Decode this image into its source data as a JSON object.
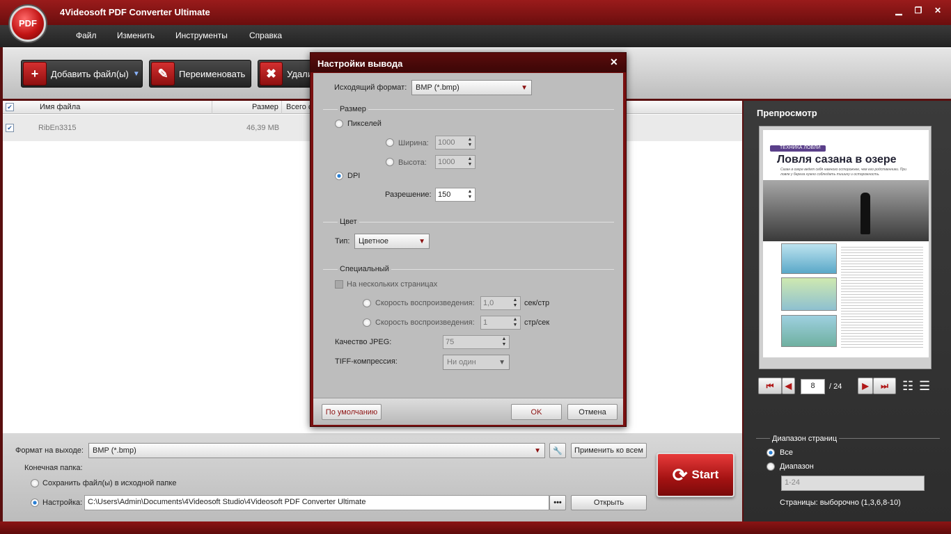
{
  "app": {
    "title": "4Videosoft PDF Converter Ultimate",
    "logo_text": "PDF"
  },
  "window_controls": {
    "minimize": "▁",
    "restore": "❐",
    "close": "✕"
  },
  "menu": [
    "Файл",
    "Изменить",
    "Инструменты",
    "Справка"
  ],
  "toolbar": {
    "add_files": "Добавить файл(ы)",
    "rename": "Переименовать",
    "delete": "Удали"
  },
  "table": {
    "columns": {
      "name": "Имя файла",
      "size": "Размер",
      "total": "Всего с"
    },
    "rows": [
      {
        "name": "RibEn3315",
        "size": "46,39 MB"
      }
    ]
  },
  "preview": {
    "title": "Препросмотр",
    "page_current": "8",
    "page_total": "/ 24",
    "doc": {
      "tag": "ТЕХНИКА ЛОВЛИ",
      "headline": "Ловля сазана в озере",
      "lead": "Сазан в озере ведет себя намного осторожнее, чем его родственники. При ловле у берега нужно соблюдать тишину и осторожность."
    },
    "range_title": "Диапазон страниц",
    "range_all": "Все",
    "range_custom": "Диапазон",
    "range_value": "1-24",
    "range_hint": "Страницы: выборочно (1,3,6,8-10)"
  },
  "bottom": {
    "format_label": "Формат на выходе:",
    "format_value": "BMP (*.bmp)",
    "apply_all": "Применить ко всем",
    "dest_label": "Конечная папка:",
    "save_source": "Сохранить файл(ы) в исходной папке",
    "custom_label": "Настройка:",
    "path": "C:\\Users\\Admin\\Documents\\4Videosoft Studio\\4Videosoft PDF Converter Ultimate",
    "browse": "•••",
    "open": "Открыть",
    "start": "Start"
  },
  "dialog": {
    "title": "Настройки вывода",
    "close": "✕",
    "out_format_label": "Исходящий формат:",
    "out_format_value": "BMP (*.bmp)",
    "size_group": "Размер",
    "pixels": "Пикселей",
    "width_label": "Ширина:",
    "width_value": "1000",
    "height_label": "Высота:",
    "height_value": "1000",
    "dpi": "DPI",
    "resolution_label": "Разрешение:",
    "resolution_value": "150",
    "color_group": "Цвет",
    "type_label": "Тип:",
    "type_value": "Цветное",
    "special_group": "Специальный",
    "multipage": "На нескольких страницах",
    "speed1_label": "Скорость воспроизведения:",
    "speed1_value": "1,0",
    "speed1_unit": "сек/стр",
    "speed2_label": "Скорость воспроизведения:",
    "speed2_value": "1",
    "speed2_unit": "стр/сек",
    "jpeg_label": "Качество JPEG:",
    "jpeg_value": "75",
    "tiff_label": "TIFF-компрессия:",
    "tiff_value": "Ни один",
    "default_btn": "По умолчанию",
    "ok_btn": "OK",
    "cancel_btn": "Отмена"
  },
  "colors": {
    "brand": "#8b1414",
    "accent": "#2a7fd4"
  }
}
